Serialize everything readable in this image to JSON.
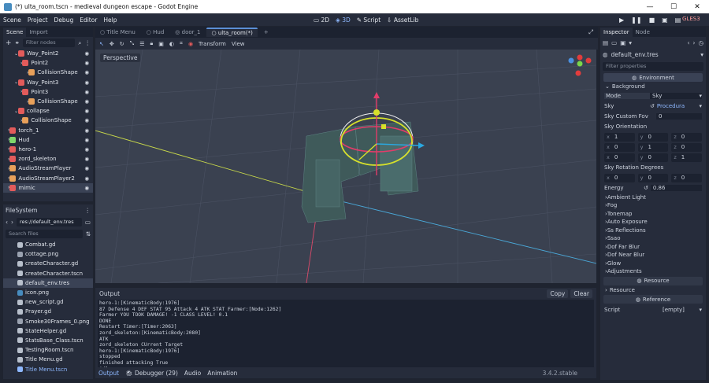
{
  "titlebar": {
    "title": "(*) ulta_room.tscn - medieval dungeon escape - Godot Engine",
    "minimize": "—",
    "maximize": "☐",
    "close": "✕"
  },
  "menubar": {
    "items": [
      "Scene",
      "Project",
      "Debug",
      "Editor",
      "Help"
    ],
    "workspaces": [
      "2D",
      "3D",
      "Script",
      "AssetLib"
    ],
    "renderer": "GLES3"
  },
  "scene_dock": {
    "tabs": [
      "Scene",
      "Import"
    ],
    "filter_placeholder": "Filter nodes",
    "nodes": [
      {
        "label": "Way_Point2",
        "depth": 1,
        "icon": "#e25b5b"
      },
      {
        "label": "Point2",
        "depth": 2,
        "icon": "#e25b5b"
      },
      {
        "label": "CollisionShape",
        "depth": 3,
        "icon": "#e8a05a"
      },
      {
        "label": "Way_Point3",
        "depth": 1,
        "icon": "#e25b5b"
      },
      {
        "label": "Point3",
        "depth": 2,
        "icon": "#e25b5b"
      },
      {
        "label": "CollisionShape",
        "depth": 3,
        "icon": "#e8a05a"
      },
      {
        "label": "collapse",
        "depth": 1,
        "icon": "#e25b5b"
      },
      {
        "label": "CollisionShape",
        "depth": 2,
        "icon": "#e8a05a"
      },
      {
        "label": "torch_1",
        "depth": 0,
        "icon": "#e25b5b"
      },
      {
        "label": "Hud",
        "depth": 0,
        "icon": "#7fd66b"
      },
      {
        "label": "hero-1",
        "depth": 0,
        "icon": "#e25b5b"
      },
      {
        "label": "zord_skeleton",
        "depth": 0,
        "icon": "#e25b5b"
      },
      {
        "label": "AudioStreamPlayer",
        "depth": 0,
        "icon": "#e8a05a"
      },
      {
        "label": "AudioStreamPlayer2",
        "depth": 0,
        "icon": "#e8a05a"
      },
      {
        "label": "mimic",
        "depth": 0,
        "icon": "#e25b5b"
      }
    ]
  },
  "filesystem": {
    "title": "FileSystem",
    "path": "res://default_env.tres",
    "search_placeholder": "Search files",
    "files": [
      {
        "label": "Combat.gd",
        "icon": "#b8c0cc"
      },
      {
        "label": "cottage.png",
        "icon": "#9aa2b0"
      },
      {
        "label": "createCharacter.gd",
        "icon": "#b8c0cc"
      },
      {
        "label": "createCharacter.tscn",
        "icon": "#b8c0cc"
      },
      {
        "label": "default_env.tres",
        "icon": "#b8c0cc"
      },
      {
        "label": "icon.png",
        "icon": "#478cbf"
      },
      {
        "label": "new_script.gd",
        "icon": "#b8c0cc"
      },
      {
        "label": "Prayer.gd",
        "icon": "#b8c0cc"
      },
      {
        "label": "Smoke30Frames_0.png",
        "icon": "#9aa2b0"
      },
      {
        "label": "StateHelper.gd",
        "icon": "#b8c0cc"
      },
      {
        "label": "StatsBase_Class.tscn",
        "icon": "#b8c0cc"
      },
      {
        "label": "TestingRoom.tscn",
        "icon": "#b8c0cc"
      },
      {
        "label": "Title Menu.gd",
        "icon": "#b8c0cc"
      },
      {
        "label": "Title Menu.tscn",
        "icon": "#8eb8ff"
      }
    ]
  },
  "editor": {
    "tabs": [
      "Title Menu",
      "Hud",
      "door_1",
      "ulta_room(*)"
    ],
    "toolbar": [
      "Transform",
      "View"
    ],
    "perspective": "Perspective"
  },
  "output": {
    "title": "Output",
    "copy": "Copy",
    "clear": "Clear",
    "lines": [
      "hero-1:[KinematicBody:1976]",
      "87 Defense 4 DEF STAT 95 Attack 4 ATK STAT Farmer:[Node:1262]",
      "Farmer YOU TOOK DAMAGE! -1 CLASS LEVEL! 0.1",
      "DONE",
      "Restart Timer:[Timer:2063]",
      "zord_skeleton:[KinematicBody:2080]",
      "ATK",
      "zord_skeleton CUrrent Target",
      "hero-1:[KinematicBody:1976]",
      "stopped",
      "finished attacking True",
      "idle"
    ],
    "bottom_tabs": [
      "Output",
      "Debugger (29)",
      "Audio",
      "Animation"
    ],
    "version": "3.4.2.stable"
  },
  "inspector": {
    "tabs": [
      "Inspector",
      "Node"
    ],
    "resource": "default_env.tres",
    "filter_placeholder": "Filter properties",
    "section": "Environment",
    "group": "Background",
    "mode_label": "Mode",
    "mode_value": "Sky",
    "sky_label": "Sky",
    "sky_value": "Procedura",
    "sky_fov_label": "Sky Custom Fov",
    "sky_fov_value": "0",
    "sky_orient_label": "Sky Orientation",
    "orient": [
      [
        "1",
        "0",
        "0"
      ],
      [
        "0",
        "1",
        "0"
      ],
      [
        "0",
        "0",
        "1"
      ]
    ],
    "rot_label": "Sky Rotation Degrees",
    "rot": [
      "0",
      "0",
      "0"
    ],
    "energy_label": "Energy",
    "energy_value": "0.86",
    "sections": [
      "Ambient Light",
      "Fog",
      "Tonemap",
      "Auto Exposure",
      "Ss Reflections",
      "Ssao",
      "Dof Far Blur",
      "Dof Near Blur",
      "Glow",
      "Adjustments"
    ],
    "resource_btn": "Resource",
    "resource_sec": "Resource",
    "reference_btn": "Reference",
    "script_label": "Script",
    "script_value": "[empty]"
  }
}
